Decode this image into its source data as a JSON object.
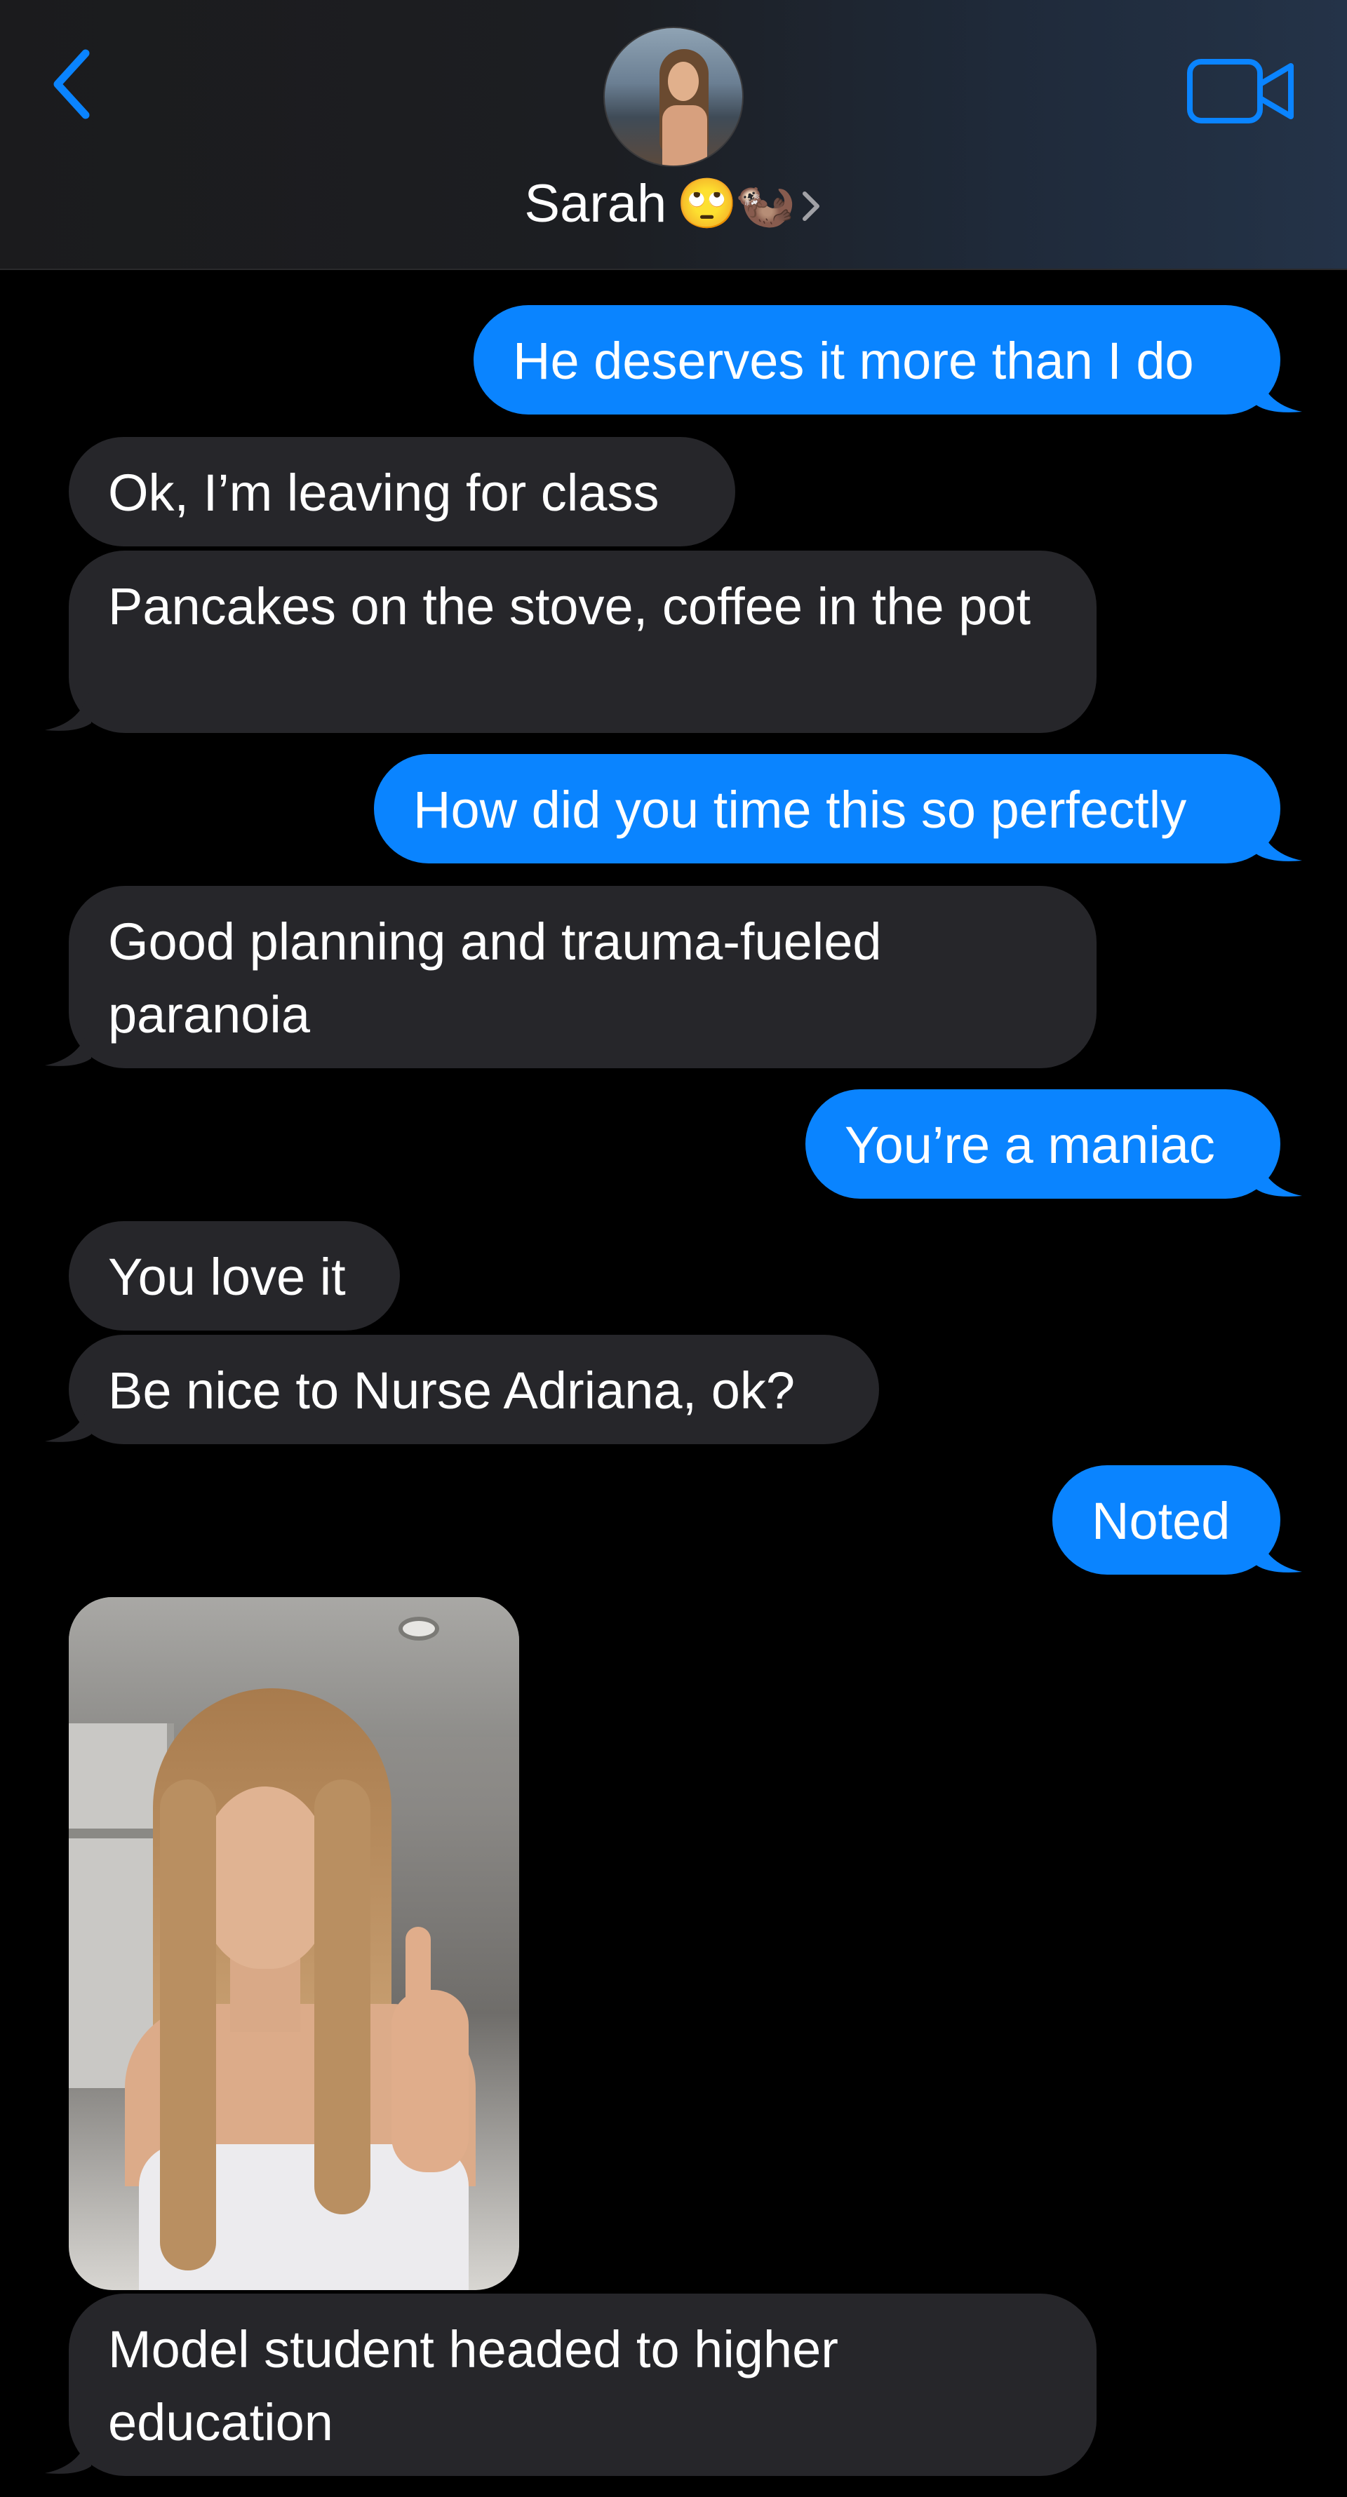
{
  "header": {
    "contact_name": "Sarah",
    "contact_emojis": [
      "🙄",
      "🦦"
    ],
    "back_icon": "chevron-left-icon",
    "video_icon": "video-camera-icon",
    "accent_color": "#0a84ff"
  },
  "messages": [
    {
      "from": "me",
      "text": "He deserves it more than I do"
    },
    {
      "from": "them",
      "text": "Ok, I’m leaving for class"
    },
    {
      "from": "them",
      "text": "Pancakes on the stove, coffee in the pot"
    },
    {
      "from": "me",
      "text": "How did you time this so perfectly"
    },
    {
      "from": "them",
      "text": "Good planning and trauma-fueled paranoia"
    },
    {
      "from": "me",
      "text": "You’re a maniac"
    },
    {
      "from": "them",
      "text": "You love it"
    },
    {
      "from": "them",
      "text": "Be nice to Nurse Adriana, ok?"
    },
    {
      "from": "me",
      "text": "Noted"
    },
    {
      "from": "them",
      "type": "photo"
    },
    {
      "from": "them",
      "text": "Model student headed to higher education"
    }
  ],
  "colors": {
    "sent_bubble": "#0a84ff",
    "received_bubble": "#26262a",
    "background": "#000000"
  }
}
